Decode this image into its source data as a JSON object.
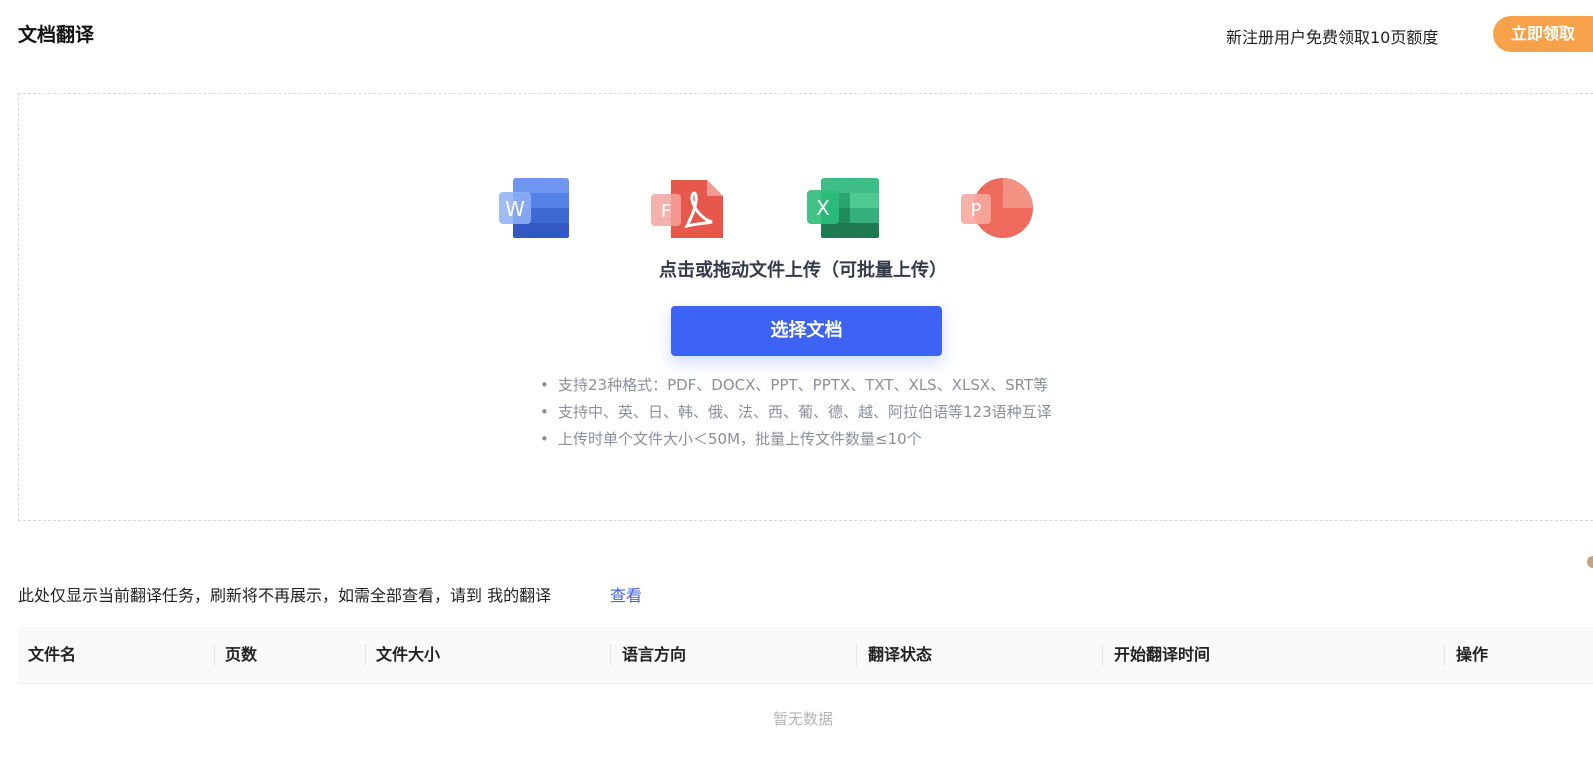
{
  "header": {
    "title": "文档翻译",
    "promo_text": "新注册用户免费领取10页额度",
    "promo_button": "立即领取"
  },
  "upload": {
    "file_icons": [
      {
        "name": "word-icon",
        "letter": "W",
        "color": "#3c6bd8"
      },
      {
        "name": "pdf-icon",
        "letter": "F",
        "color": "#e2453c"
      },
      {
        "name": "excel-icon",
        "letter": "X",
        "color": "#21a366"
      },
      {
        "name": "powerpoint-icon",
        "letter": "P",
        "color": "#e84e3c"
      }
    ],
    "hint": "点击或拖动文件上传（可批量上传）",
    "button": "选择文档",
    "notes": [
      "支持23种格式：PDF、DOCX、PPT、PPTX、TXT、XLS、XLSX、SRT等",
      "支持中、英、日、韩、俄、法、西、葡、德、越、阿拉伯语等123语种互译",
      "上传时单个文件大小＜50M，批量上传文件数量≤10个"
    ]
  },
  "info": {
    "text": "此处仅显示当前翻译任务，刷新将不再展示，如需全部查看，请到 我的翻译",
    "link": "查看"
  },
  "table": {
    "columns": [
      "文件名",
      "页数",
      "文件大小",
      "语言方向",
      "翻译状态",
      "开始翻译时间",
      "操作"
    ],
    "empty_text": "暂无数据"
  }
}
